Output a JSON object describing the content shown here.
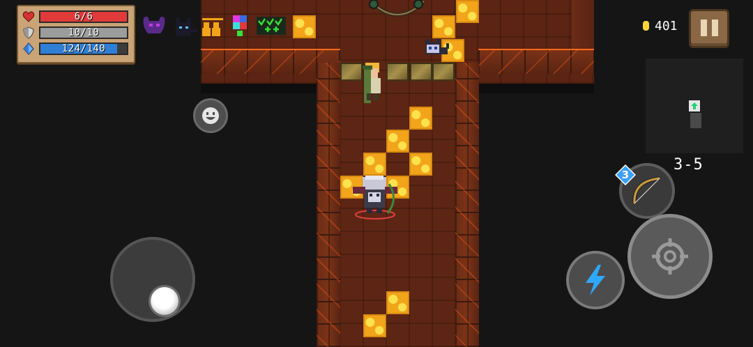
{
  "hud": {
    "health": {
      "label": "6/6",
      "value": 6,
      "max": 6,
      "color": "#e03a3a"
    },
    "armor": {
      "label": "10/10",
      "value": 10,
      "max": 10,
      "color": "#9c9c9c"
    },
    "energy": {
      "label": "124/140",
      "value": 124,
      "max": 140,
      "color": "#2f7fd6"
    },
    "buffs": [
      "demon-horns-icon",
      "black-cat-icon",
      "followers-icon",
      "mystery-cube-icon",
      "check-plus-icon"
    ]
  },
  "top_right": {
    "coins": "401",
    "pause_icon": "pause-icon"
  },
  "level": "3-5",
  "weapon": {
    "energy_cost": "3",
    "icon": "bow-icon"
  },
  "controls": {
    "emote_icon": "smiley-icon",
    "skill_icon": "lightning-icon",
    "fire_icon": "crosshair-icon",
    "joystick": "move-joystick"
  },
  "colors": {
    "lava": "#f2a51a",
    "floor": "#5b2413",
    "wall_glow": "#ff6a1a",
    "skill_bolt": "#2fa8ff"
  }
}
